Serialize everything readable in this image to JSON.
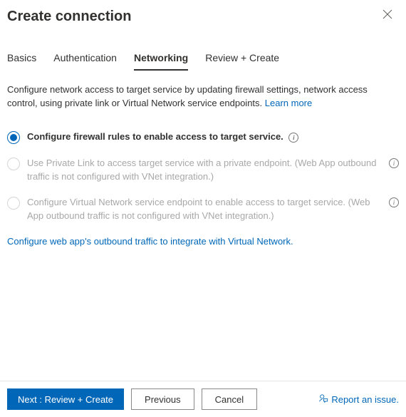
{
  "header": {
    "title": "Create connection"
  },
  "tabs": {
    "basics": "Basics",
    "authentication": "Authentication",
    "networking": "Networking",
    "review": "Review + Create"
  },
  "networking": {
    "description": "Configure network access to target service by updating firewall settings, network access control, using private link or Virtual Network service endpoints. ",
    "learn_more": "Learn more",
    "options": {
      "firewall": "Configure firewall rules to enable access to target service.",
      "private_link": "Use Private Link to access target service with a private endpoint. (Web App outbound traffic is not configured with VNet integration.)",
      "service_endpoint": "Configure Virtual Network service endpoint to enable access to target service. (Web App outbound traffic is not configured with VNet integration.)"
    },
    "vnet_link": "Configure web app's outbound traffic to integrate with Virtual Network."
  },
  "footer": {
    "next": "Next : Review + Create",
    "previous": "Previous",
    "cancel": "Cancel",
    "report": "Report an issue."
  }
}
